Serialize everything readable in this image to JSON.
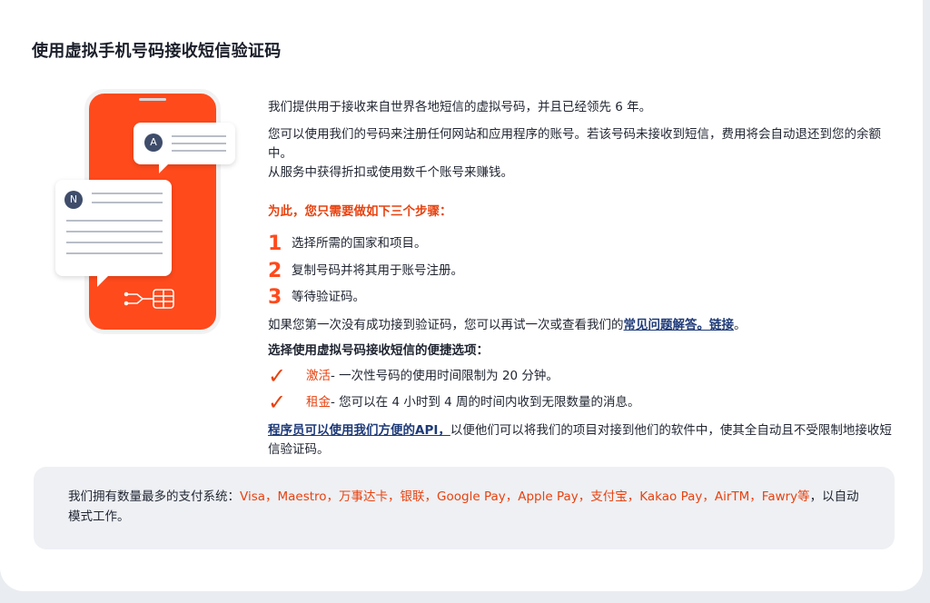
{
  "title": "使用虚拟手机号码接收短信验证码",
  "illustration": {
    "avatar_a": "A",
    "avatar_n": "N"
  },
  "intro": {
    "p1": "我们提供用于接收来自世界各地短信的虚拟号码，并且已经领先 6 年。",
    "p2": "您可以使用我们的号码来注册任何网站和应用程序的账号。若该号码未接收到短信，费用将会自动退还到您的余额中。",
    "p3": "从服务中获得折扣或使用数千个账号来赚钱。"
  },
  "steps": {
    "heading": "为此，您只需要做如下三个步骤：",
    "items": [
      {
        "num": "1",
        "text": "选择所需的国家和项目。"
      },
      {
        "num": "2",
        "text": "复制号码并将其用于账号注册。"
      },
      {
        "num": "3",
        "text": "等待验证码。"
      }
    ]
  },
  "faq": {
    "before": "如果您第一次没有成功接到验证码，您可以再试一次或查看我们的",
    "link": "常见问题解答。链接",
    "after": "。"
  },
  "options": {
    "heading": "选择使用虚拟号码接收短信的便捷选项：",
    "items": [
      {
        "icon": "check-icon",
        "label": "激活",
        "desc": " - 一次性号码的使用时间限制为 20 分钟。"
      },
      {
        "icon": "check-icon",
        "label": "租金",
        "desc": " - 您可以在 4 小时到 4 周的时间内收到无限数量的消息。"
      }
    ]
  },
  "api": {
    "link": "程序员可以使用我们方便的API，",
    "text": "以便他们可以将我们的项目对接到他们的软件中，使其全自动且不受限制地接收短信验证码。"
  },
  "payment": {
    "prefix": "我们拥有数量最多的支付系统：",
    "systems": "Visa，Maestro，万事达卡，银联，Google Pay，Apple Pay，支付宝，Kakao Pay，AirTM，Fawry等",
    "suffix": "，以自动模式工作。"
  },
  "colors": {
    "accent": "#e8420f",
    "phone": "#ff4a1c",
    "link": "#1e3a78"
  }
}
